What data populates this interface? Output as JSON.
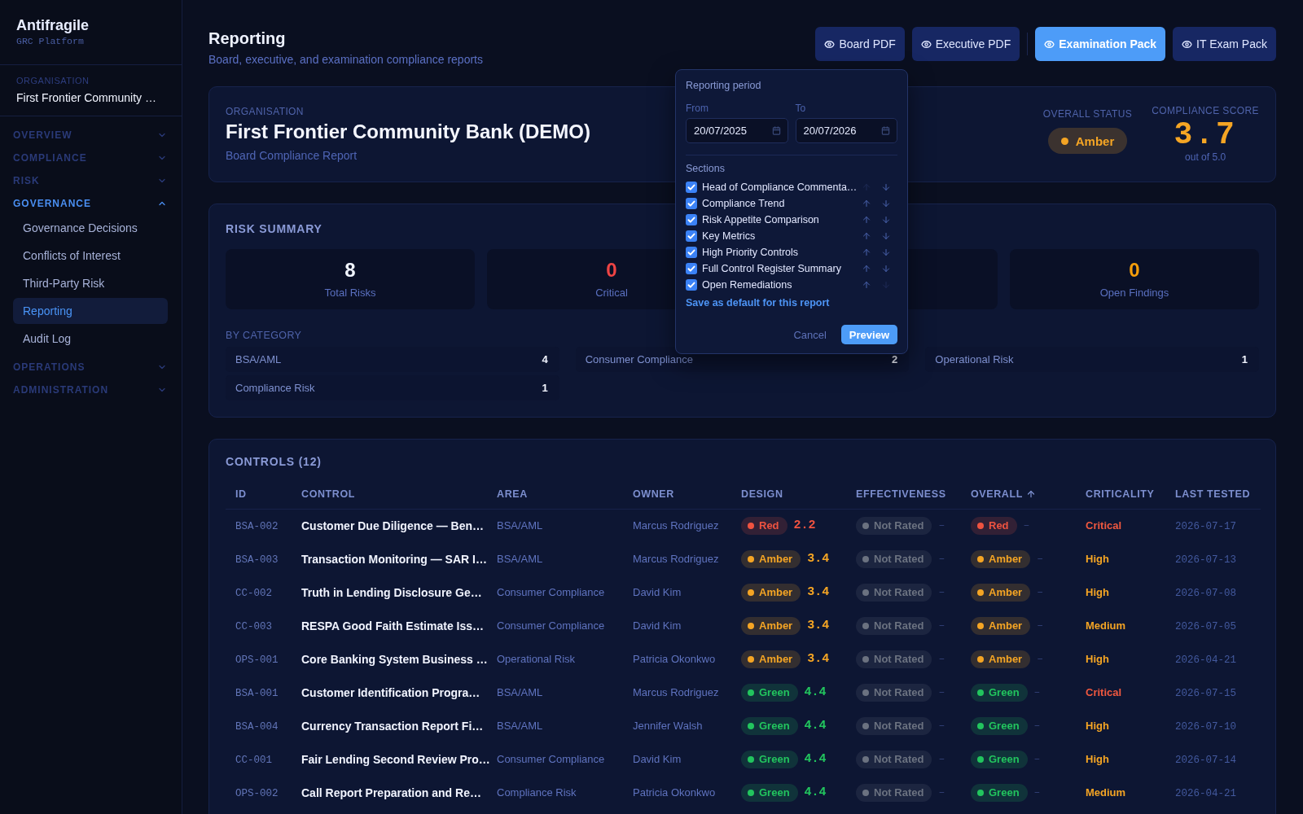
{
  "sidebar": {
    "brand": {
      "name": "Antifragile",
      "tagline": "GRC Platform"
    },
    "organisation": {
      "label": "ORGANISATION",
      "name": "First Frontier Community …"
    },
    "nav": [
      {
        "label": "OVERVIEW",
        "expanded": false
      },
      {
        "label": "COMPLIANCE",
        "expanded": false
      },
      {
        "label": "RISK",
        "expanded": false
      },
      {
        "label": "GOVERNANCE",
        "expanded": true,
        "children": [
          {
            "label": "Governance Decisions",
            "selected": false
          },
          {
            "label": "Conflicts of Interest",
            "selected": false
          },
          {
            "label": "Third-Party Risk",
            "selected": false
          },
          {
            "label": "Reporting",
            "selected": true
          },
          {
            "label": "Audit Log",
            "selected": false
          }
        ]
      },
      {
        "label": "OPERATIONS",
        "expanded": false
      },
      {
        "label": "ADMINISTRATION",
        "expanded": false
      }
    ]
  },
  "header": {
    "title": "Reporting",
    "subtitle": "Board, executive, and examination compliance reports",
    "button_groups": [
      {
        "buttons": [
          {
            "label": "Board PDF",
            "selected": false
          },
          {
            "label": "Executive PDF",
            "selected": false
          }
        ]
      },
      {
        "buttons": [
          {
            "label": "Examination Pack",
            "selected": true
          },
          {
            "label": "IT Exam Pack",
            "selected": false
          }
        ]
      }
    ]
  },
  "report_options": {
    "period_title": "Reporting period",
    "from": {
      "label": "From",
      "value": "20/07/2025"
    },
    "to": {
      "label": "To",
      "value": "20/07/2026"
    },
    "sections_title": "Sections",
    "sections": [
      {
        "label": "Head of Compliance Commenta…",
        "checked": true,
        "movable_up": false,
        "movable_down": true
      },
      {
        "label": "Compliance Trend",
        "checked": true,
        "movable_up": true,
        "movable_down": true
      },
      {
        "label": "Risk Appetite Comparison",
        "checked": true,
        "movable_up": true,
        "movable_down": true
      },
      {
        "label": "Key Metrics",
        "checked": true,
        "movable_up": true,
        "movable_down": true
      },
      {
        "label": "High Priority Controls",
        "checked": true,
        "movable_up": true,
        "movable_down": true
      },
      {
        "label": "Full Control Register Summary",
        "checked": true,
        "movable_up": true,
        "movable_down": true
      },
      {
        "label": "Open Remediations",
        "checked": true,
        "movable_up": true,
        "movable_down": false
      }
    ],
    "save_default": "Save as default for this report",
    "cancel": "Cancel",
    "preview": "Preview"
  },
  "organisation_card": {
    "label": "ORGANISATION",
    "name": "First Frontier Community Bank (DEMO)",
    "report": "Board Compliance Report",
    "status": {
      "label": "OVERALL STATUS",
      "value": "Amber",
      "color": "#f5a524"
    },
    "score": {
      "label": "COMPLIANCE SCORE",
      "value": "3.7",
      "scale": "out of 5.0"
    }
  },
  "risk_summary": {
    "title": "RISK SUMMARY",
    "stats": [
      {
        "value": "8",
        "label": "Total Risks",
        "color": "#f1f5ff"
      },
      {
        "value": "0",
        "label": "Critical",
        "color": "#ef4444"
      },
      {
        "value": "0",
        "label": "Open Findings",
        "color": "#f59e0b"
      }
    ],
    "category_title": "BY CATEGORY",
    "categories": [
      {
        "label": "BSA/AML",
        "count": "4"
      },
      {
        "label": "Consumer Compliance",
        "count": "2"
      },
      {
        "label": "Operational Risk",
        "count": "1"
      },
      {
        "label": "Compliance Risk",
        "count": "1"
      }
    ]
  },
  "controls": {
    "title": "CONTROLS (12)",
    "columns": [
      {
        "label": "ID",
        "sorted": false
      },
      {
        "label": "CONTROL",
        "sorted": false
      },
      {
        "label": "AREA",
        "sorted": false
      },
      {
        "label": "OWNER",
        "sorted": false
      },
      {
        "label": "DESIGN",
        "sorted": false
      },
      {
        "label": "EFFECTIVENESS",
        "sorted": false
      },
      {
        "label": "OVERALL",
        "sorted": true
      },
      {
        "label": "CRITICALITY",
        "sorted": false
      },
      {
        "label": "LAST TESTED",
        "sorted": false
      }
    ],
    "rows": [
      {
        "id": "BSA-002",
        "control": "Customer Due Diligence — Ben…",
        "area": "BSA/AML",
        "owner": "Marcus Rodriguez",
        "design": {
          "label": "Red",
          "color": "#ef5340",
          "score": "2.2",
          "scored": true
        },
        "effectiveness": {
          "label": "Not Rated",
          "color": "#6b7280",
          "score": "–",
          "scored": false
        },
        "overall": {
          "label": "Red",
          "color": "#ef5340",
          "score": "–",
          "scored": false
        },
        "criticality": {
          "label": "Critical",
          "color": "#f0583f"
        },
        "last_tested": "2026-07-17"
      },
      {
        "id": "BSA-003",
        "control": "Transaction Monitoring — SAR I…",
        "area": "BSA/AML",
        "owner": "Marcus Rodriguez",
        "design": {
          "label": "Amber",
          "color": "#f5a524",
          "score": "3.4",
          "scored": true
        },
        "effectiveness": {
          "label": "Not Rated",
          "color": "#6b7280",
          "score": "–",
          "scored": false
        },
        "overall": {
          "label": "Amber",
          "color": "#f5a524",
          "score": "–",
          "scored": false
        },
        "criticality": {
          "label": "High",
          "color": "#f5a524"
        },
        "last_tested": "2026-07-13"
      },
      {
        "id": "CC-002",
        "control": "Truth in Lending Disclosure Ge…",
        "area": "Consumer Compliance",
        "owner": "David Kim",
        "design": {
          "label": "Amber",
          "color": "#f5a524",
          "score": "3.4",
          "scored": true
        },
        "effectiveness": {
          "label": "Not Rated",
          "color": "#6b7280",
          "score": "–",
          "scored": false
        },
        "overall": {
          "label": "Amber",
          "color": "#f5a524",
          "score": "–",
          "scored": false
        },
        "criticality": {
          "label": "High",
          "color": "#f5a524"
        },
        "last_tested": "2026-07-08"
      },
      {
        "id": "CC-003",
        "control": "RESPA Good Faith Estimate Iss…",
        "area": "Consumer Compliance",
        "owner": "David Kim",
        "design": {
          "label": "Amber",
          "color": "#f5a524",
          "score": "3.4",
          "scored": true
        },
        "effectiveness": {
          "label": "Not Rated",
          "color": "#6b7280",
          "score": "–",
          "scored": false
        },
        "overall": {
          "label": "Amber",
          "color": "#f5a524",
          "score": "–",
          "scored": false
        },
        "criticality": {
          "label": "Medium",
          "color": "#f5a524"
        },
        "last_tested": "2026-07-05"
      },
      {
        "id": "OPS-001",
        "control": "Core Banking System Business …",
        "area": "Operational Risk",
        "owner": "Patricia Okonkwo",
        "design": {
          "label": "Amber",
          "color": "#f5a524",
          "score": "3.4",
          "scored": true
        },
        "effectiveness": {
          "label": "Not Rated",
          "color": "#6b7280",
          "score": "–",
          "scored": false
        },
        "overall": {
          "label": "Amber",
          "color": "#f5a524",
          "score": "–",
          "scored": false
        },
        "criticality": {
          "label": "High",
          "color": "#f5a524"
        },
        "last_tested": "2026-04-21"
      },
      {
        "id": "BSA-001",
        "control": "Customer Identification Progra…",
        "area": "BSA/AML",
        "owner": "Marcus Rodriguez",
        "design": {
          "label": "Green",
          "color": "#22c55e",
          "score": "4.4",
          "scored": true
        },
        "effectiveness": {
          "label": "Not Rated",
          "color": "#6b7280",
          "score": "–",
          "scored": false
        },
        "overall": {
          "label": "Green",
          "color": "#22c55e",
          "score": "–",
          "scored": false
        },
        "criticality": {
          "label": "Critical",
          "color": "#f0583f"
        },
        "last_tested": "2026-07-15"
      },
      {
        "id": "BSA-004",
        "control": "Currency Transaction Report Fi…",
        "area": "BSA/AML",
        "owner": "Jennifer Walsh",
        "design": {
          "label": "Green",
          "color": "#22c55e",
          "score": "4.4",
          "scored": true
        },
        "effectiveness": {
          "label": "Not Rated",
          "color": "#6b7280",
          "score": "–",
          "scored": false
        },
        "overall": {
          "label": "Green",
          "color": "#22c55e",
          "score": "–",
          "scored": false
        },
        "criticality": {
          "label": "High",
          "color": "#f5a524"
        },
        "last_tested": "2026-07-10"
      },
      {
        "id": "CC-001",
        "control": "Fair Lending Second Review Pro…",
        "area": "Consumer Compliance",
        "owner": "David Kim",
        "design": {
          "label": "Green",
          "color": "#22c55e",
          "score": "4.4",
          "scored": true
        },
        "effectiveness": {
          "label": "Not Rated",
          "color": "#6b7280",
          "score": "–",
          "scored": false
        },
        "overall": {
          "label": "Green",
          "color": "#22c55e",
          "score": "–",
          "scored": false
        },
        "criticality": {
          "label": "High",
          "color": "#f5a524"
        },
        "last_tested": "2026-07-14"
      },
      {
        "id": "OPS-002",
        "control": "Call Report Preparation and Re…",
        "area": "Compliance Risk",
        "owner": "Patricia Okonkwo",
        "design": {
          "label": "Green",
          "color": "#22c55e",
          "score": "4.4",
          "scored": true
        },
        "effectiveness": {
          "label": "Not Rated",
          "color": "#6b7280",
          "score": "–",
          "scored": false
        },
        "overall": {
          "label": "Green",
          "color": "#22c55e",
          "score": "–",
          "scored": false
        },
        "criticality": {
          "label": "Medium",
          "color": "#f5a524"
        },
        "last_tested": "2026-04-21"
      }
    ]
  }
}
